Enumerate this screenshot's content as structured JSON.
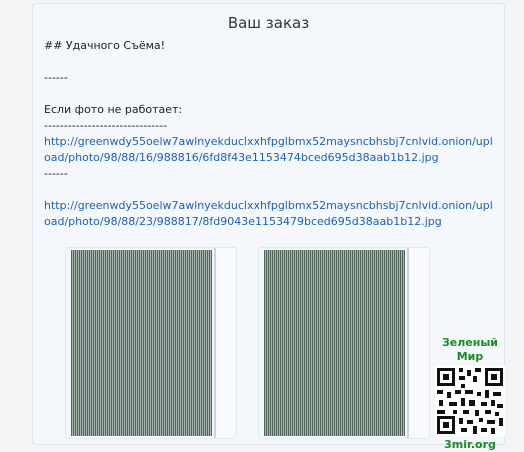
{
  "order": {
    "title": "Ваш заказ",
    "lines": [
      "## Удачного Съёма!",
      "",
      "------",
      "",
      "Если фото не работает:",
      "-------------------------------"
    ],
    "link1": "http://greenwdy55oelw7awlnyekduclxxhfpglbmx52maysncbhsbj7cnlvid.onion/upload/photo/98/88/16/988816/6fd8f43e1153474bced695d38aab1b12.jpg",
    "separator2": "------",
    "link2": "http://greenwdy55oelw7awlnyekduclxxhfpglbmx52maysncbhsbj7cnlvid.onion/upload/photo/98/88/23/988817/8fd9043e1153479bced695d38aab1b12.jpg"
  },
  "watermark": {
    "top_text": "Зеленый Мир",
    "bottom_text": "3mir.org",
    "color": "#1a8a22"
  }
}
